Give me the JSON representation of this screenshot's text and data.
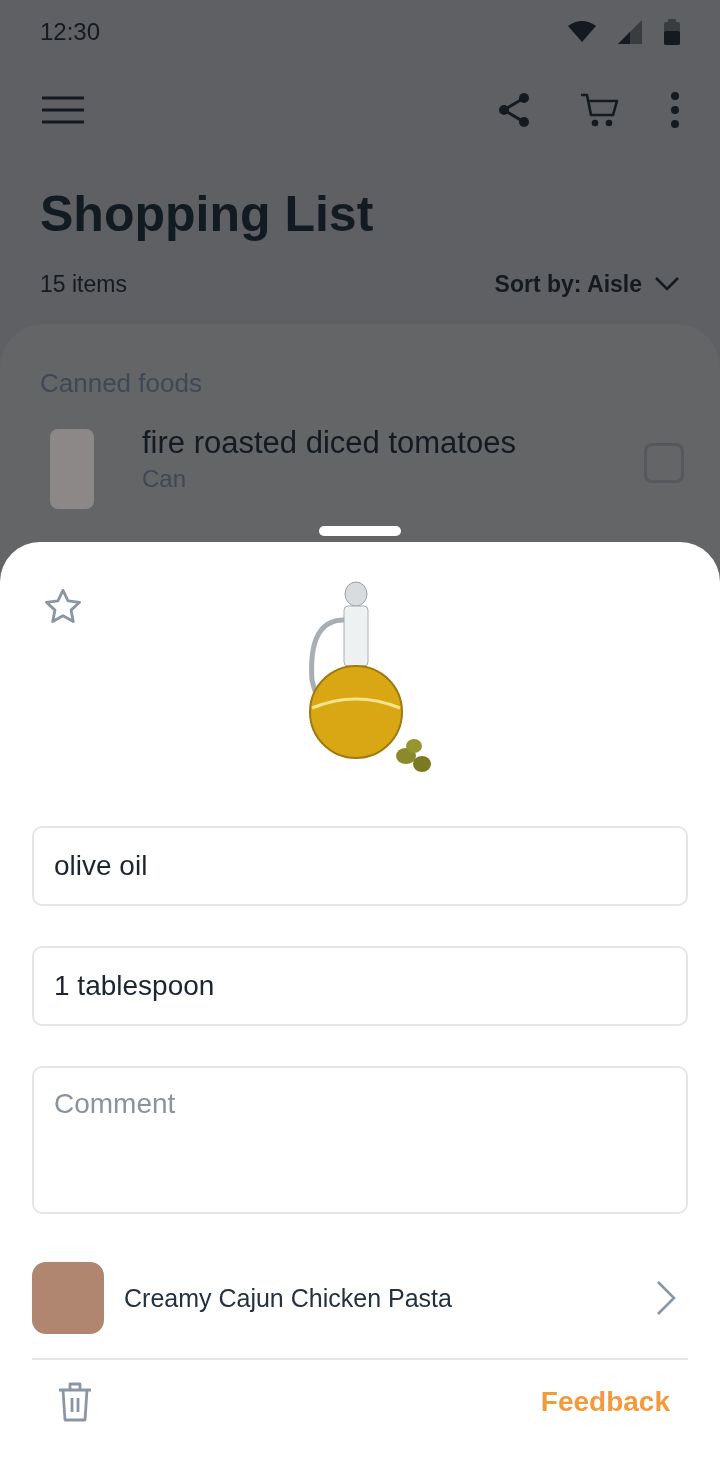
{
  "status_bar": {
    "time": "12:30"
  },
  "header": {
    "title": "Shopping List",
    "item_count": "15 items",
    "sort": "Sort by: Aisle"
  },
  "list": {
    "section": "Canned foods",
    "items": [
      {
        "name": "fire roasted diced tomatoes",
        "unit": "Can",
        "checked": false
      }
    ]
  },
  "sheet": {
    "favorite": false,
    "name": {
      "value": "olive oil"
    },
    "quantity": {
      "value": "1 tablespoon"
    },
    "comment": {
      "placeholder": "Comment"
    },
    "recipe": {
      "title": "Creamy Cajun Chicken Pasta"
    },
    "feedback": "Feedback"
  }
}
